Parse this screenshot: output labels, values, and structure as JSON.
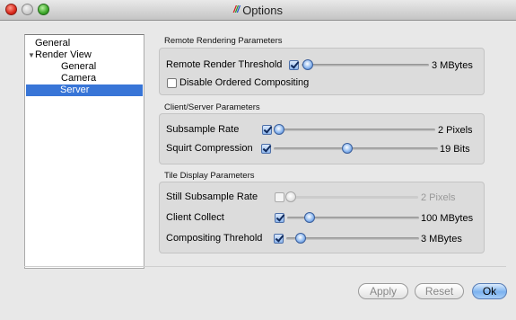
{
  "window": {
    "title": "Options",
    "app_icon": "paraview-logo-icon"
  },
  "tree": {
    "items": [
      {
        "label": "General"
      },
      {
        "label": "Render View",
        "expanded": true
      },
      {
        "label": "General"
      },
      {
        "label": "Camera"
      },
      {
        "label": "Server",
        "selected": true
      }
    ]
  },
  "remote": {
    "title": "Remote Rendering Parameters",
    "threshold": {
      "label": "Remote Render Threshold",
      "checked": true,
      "level": 0.05,
      "value": "3 MBytes"
    },
    "ordered": {
      "label": "Disable Ordered Compositing",
      "checked": false
    }
  },
  "client_server": {
    "title": "Client/Server Parameters",
    "subsample": {
      "label": "Subsample Rate",
      "checked": true,
      "level": 0.03,
      "value": "2 Pixels"
    },
    "squirt": {
      "label": "Squirt Compression",
      "checked": true,
      "level": 0.45,
      "value": "19 Bits"
    }
  },
  "tile": {
    "title": "Tile Display Parameters",
    "still": {
      "label": "Still Subsample Rate",
      "checked": false,
      "enabled": false,
      "level": 0.03,
      "value": "2 Pixels"
    },
    "collect": {
      "label": "Client Collect",
      "checked": true,
      "level": 0.17,
      "value": "100 MBytes"
    },
    "compositing": {
      "label": "Compositing Threhold",
      "checked": true,
      "level": 0.11,
      "value": "3 MBytes"
    }
  },
  "buttons": {
    "apply": "Apply",
    "reset": "Reset",
    "ok": "Ok"
  },
  "colors": {
    "selection": "#3875d7",
    "ok_button": "#7cb2ef",
    "slider_knob": "#8fb9ef"
  }
}
